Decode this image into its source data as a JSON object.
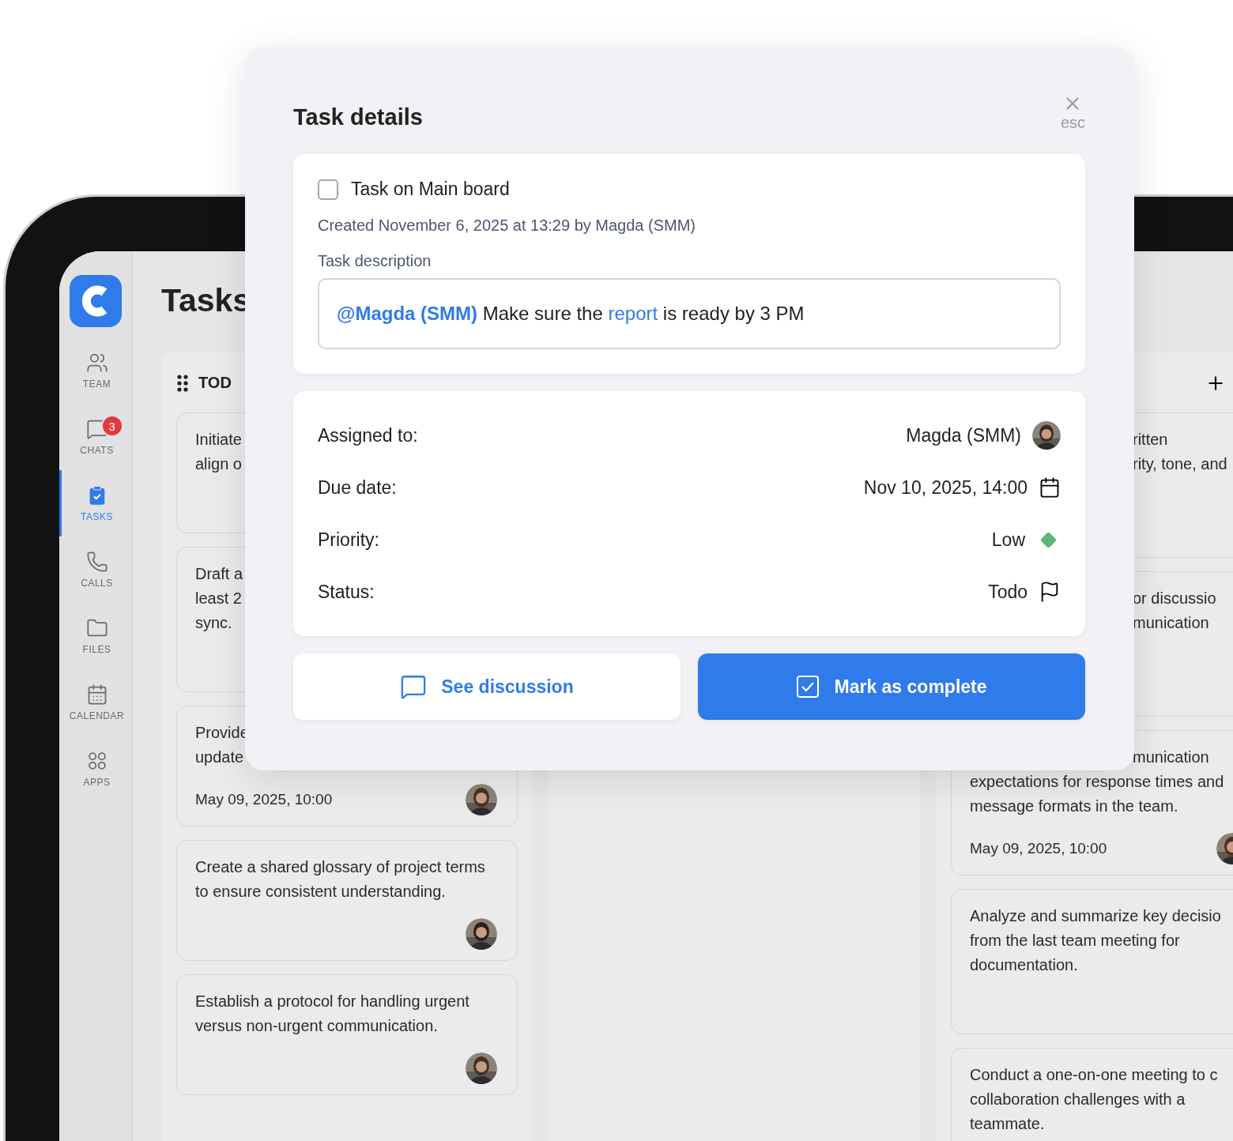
{
  "sidebar": {
    "items": [
      {
        "label": "TEAM",
        "kind": "team",
        "selected": false
      },
      {
        "label": "CHATS",
        "kind": "chats",
        "selected": false,
        "badge": "3"
      },
      {
        "label": "TASKS",
        "kind": "tasks",
        "selected": true
      },
      {
        "label": "CALLS",
        "kind": "calls",
        "selected": false
      },
      {
        "label": "FILES",
        "kind": "files",
        "selected": false
      },
      {
        "label": "CALENDAR",
        "kind": "calendar",
        "selected": false
      },
      {
        "label": "APPS",
        "kind": "apps",
        "selected": false
      }
    ]
  },
  "page": {
    "title": "Tasks"
  },
  "columns": [
    {
      "kind": "titled",
      "title": "TOD",
      "cards": [
        {
          "lines": [
            {
              "text": "Initiate",
              "covered": false
            },
            {
              "text": "align o",
              "covered": false
            }
          ]
        },
        {
          "lines": [
            {
              "text": "Draft a",
              "covered": false
            },
            {
              "text": "least 2",
              "covered": false
            },
            {
              "text": "sync.",
              "covered": false
            }
          ]
        },
        {
          "lines": [
            {
              "text": "Provide",
              "covered": false
            },
            {
              "text": "update",
              "covered": false
            }
          ],
          "date": "May 09, 2025, 10:00",
          "avatar": true
        },
        {
          "lines": [
            {
              "text": "Create a shared glossary of project terms",
              "covered": false
            },
            {
              "text": "to ensure consistent understanding.",
              "covered": false
            }
          ],
          "avatar": true
        },
        {
          "lines": [
            {
              "text": "Establish a protocol for handling urgent",
              "covered": false
            },
            {
              "text": "versus non-urgent communication.",
              "covered": false
            }
          ],
          "avatar": true
        }
      ]
    },
    {
      "kind": "plain"
    },
    {
      "kind": "addable",
      "cards": [
        {
          "kind": "tall",
          "lines": [
            {
              "text": "ritten",
              "covered": true
            },
            {
              "text": "rity, tone, and",
              "covered": true
            }
          ]
        },
        {
          "kind": "tall",
          "lines": [
            {
              "text": "or discussio",
              "covered": true
            },
            {
              "text": "munication",
              "covered": true
            }
          ]
        },
        {
          "lines": [
            {
              "text": "munication",
              "covered": true
            },
            {
              "text": "expectations for response times and",
              "covered": false
            },
            {
              "text": "message formats in the team.",
              "covered": false
            }
          ],
          "date": "May 09, 2025, 10:00",
          "avatar": true
        },
        {
          "lines": [
            {
              "text": "Analyze and summarize key decisio",
              "covered": false
            },
            {
              "text": "from the last team meeting for",
              "covered": false
            },
            {
              "text": "documentation.",
              "covered": false
            }
          ],
          "avatar": false
        },
        {
          "lines": [
            {
              "text": "Conduct a one-on-one meeting to c",
              "covered": false
            },
            {
              "text": "collaboration challenges with a",
              "covered": false
            },
            {
              "text": "teammate."
            }
          ]
        }
      ]
    }
  ],
  "modal": {
    "title": "Task details",
    "close_hint": "esc",
    "task": {
      "title": "Task on Main board",
      "checked": false
    },
    "created": "Created November 6, 2025 at 13:29 by Magda (SMM)",
    "description_label": "Task description",
    "description": [
      {
        "kind": "mention",
        "text": "@Magda (SMM)"
      },
      {
        "kind": "plain",
        "text": " Make sure the "
      },
      {
        "kind": "link",
        "text": "report"
      },
      {
        "kind": "plain",
        "text": " is ready by 3 PM"
      }
    ],
    "details": [
      {
        "kind": "person",
        "label": "Assigned to:",
        "value": "Magda (SMM)"
      },
      {
        "kind": "date",
        "label": "Due date:",
        "value": "Nov 10, 2025, 14:00"
      },
      {
        "kind": "priority",
        "label": "Priority:",
        "value": "Low",
        "color": "#5cb874"
      },
      {
        "kind": "status",
        "label": "Status:",
        "value": "Todo"
      }
    ],
    "buttons": [
      {
        "kind": "secondary",
        "label": "See discussion"
      },
      {
        "kind": "primary",
        "label": "Mark as complete"
      }
    ]
  }
}
